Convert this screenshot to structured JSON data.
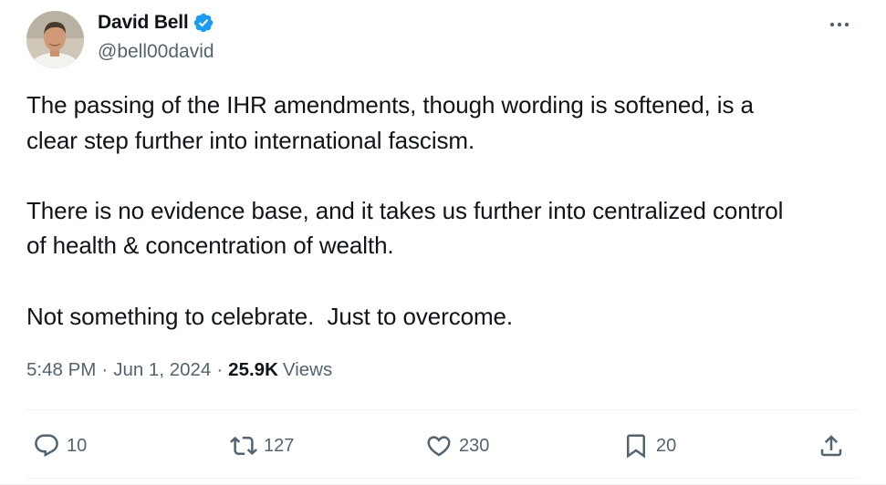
{
  "author": {
    "display_name": "David Bell",
    "handle": "@bell00david",
    "verified": true,
    "verified_icon": "verified-badge-icon",
    "avatar_icon": "avatar-photo"
  },
  "tweet": {
    "text": "The passing of the IHR amendments, though wording is softened, is a\nclear step further into international fascism.\n\nThere is no evidence base, and it takes us further into centralized control\nof health & concentration of wealth.\n\nNot something to celebrate.  Just to overcome.",
    "time": "5:48 PM",
    "separator": "·",
    "date": "Jun 1, 2024",
    "views_count": "25.9K",
    "views_label": "Views"
  },
  "actions": {
    "reply": {
      "icon": "reply-icon",
      "count": "10"
    },
    "retweet": {
      "icon": "retweet-icon",
      "count": "127"
    },
    "like": {
      "icon": "heart-icon",
      "count": "230"
    },
    "bookmark": {
      "icon": "bookmark-icon",
      "count": "20"
    },
    "share": {
      "icon": "share-icon"
    }
  },
  "colors": {
    "text_primary": "#0f1419",
    "text_secondary": "#536471",
    "verified_blue": "#1d9bf0",
    "divider": "#eff3f4"
  }
}
